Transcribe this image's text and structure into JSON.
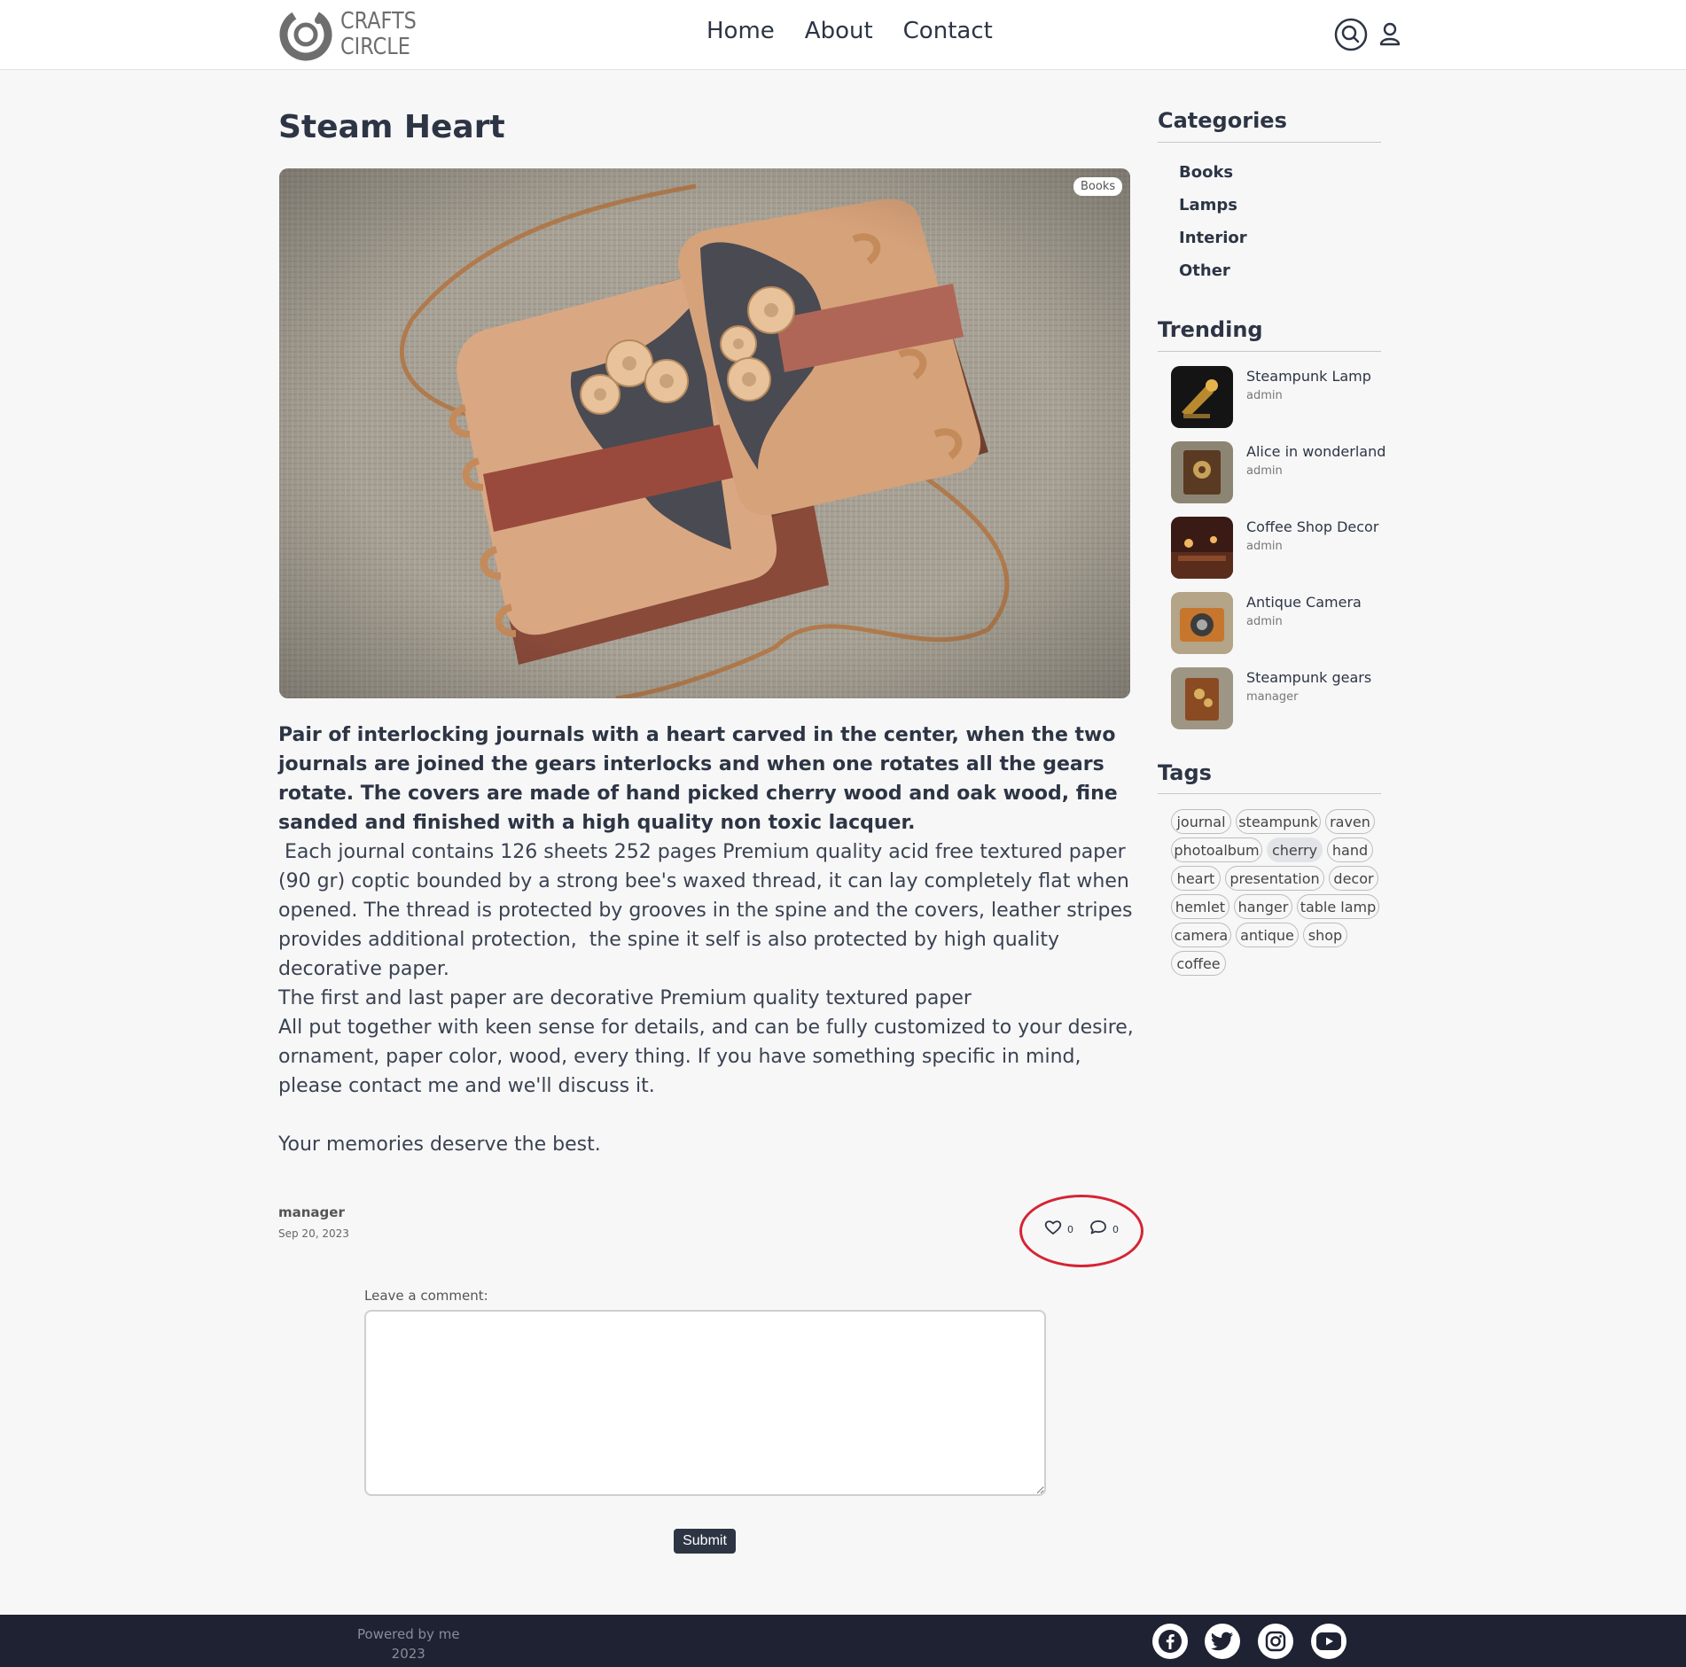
{
  "brand": {
    "line1": "CRAFTS",
    "line2": "CIRCLE"
  },
  "nav": [
    {
      "label": "Home"
    },
    {
      "label": "About"
    },
    {
      "label": "Contact"
    }
  ],
  "header_icons": [
    "search-icon",
    "user-icon"
  ],
  "post": {
    "title": "Steam Heart",
    "category_badge": "Books",
    "lead": "Pair of interlocking journals with a heart carved in the center, when the two journals are joined  the gears interlocks and when one rotates all the gears rotate. The covers are made of hand picked cherry wood and oak wood, fine sanded and finished with a high quality non toxic lacquer.",
    "body": [
      " Each journal contains 126 sheets 252 pages Premium quality acid free textured paper (90 gr) coptic bounded by a strong bee's waxed thread, it can lay completely flat when opened. The thread is protected by grooves in the spine and the covers, leather stripes provides additional protection,  the spine it self is also protected by high quality decorative paper.",
      "The first and last paper are decorative  Premium quality textured paper",
      "All put together with keen sense for details, and can be fully customized to your desire, ornament, paper color, wood, every thing. If you have something specific in mind, please contact me and we'll discuss it.",
      "Your memories deserve the best."
    ],
    "author": "manager",
    "date": "Sep 20, 2023",
    "likes": "0",
    "comments": "0"
  },
  "comment_form": {
    "label": "Leave a comment:",
    "value": "",
    "submit_label": "Submit"
  },
  "sidebar": {
    "categories_heading": "Categories",
    "categories": [
      {
        "label": "Books"
      },
      {
        "label": "Lamps"
      },
      {
        "label": "Interior"
      },
      {
        "label": "Other"
      }
    ],
    "trending_heading": "Trending",
    "trending": [
      {
        "title": "Steampunk Lamp",
        "author": "admin"
      },
      {
        "title": "Alice in wonderland",
        "author": "admin"
      },
      {
        "title": "Coffee Shop Decor",
        "author": "admin"
      },
      {
        "title": "Antique Camera",
        "author": "admin"
      },
      {
        "title": "Steampunk gears",
        "author": "manager"
      }
    ],
    "tags_heading": "Tags",
    "tags": [
      {
        "label": "journal"
      },
      {
        "label": "steampunk"
      },
      {
        "label": "raven"
      },
      {
        "label": "photoalbum"
      },
      {
        "label": "cherry"
      },
      {
        "label": "hand"
      },
      {
        "label": "heart"
      },
      {
        "label": "presentation"
      },
      {
        "label": "decor"
      },
      {
        "label": "hemlet"
      },
      {
        "label": "hanger"
      },
      {
        "label": "table lamp"
      },
      {
        "label": "camera"
      },
      {
        "label": "antique"
      },
      {
        "label": "shop"
      },
      {
        "label": "coffee"
      }
    ]
  },
  "footer": {
    "powered_by": "Powered by me",
    "year": "2023",
    "social": [
      "facebook-icon",
      "twitter-icon",
      "instagram-icon",
      "youtube-icon"
    ]
  },
  "colors": {
    "primary": "#2d3545",
    "background": "#f7f7f7",
    "footer": "#1e2233",
    "highlight": "#d62433"
  }
}
